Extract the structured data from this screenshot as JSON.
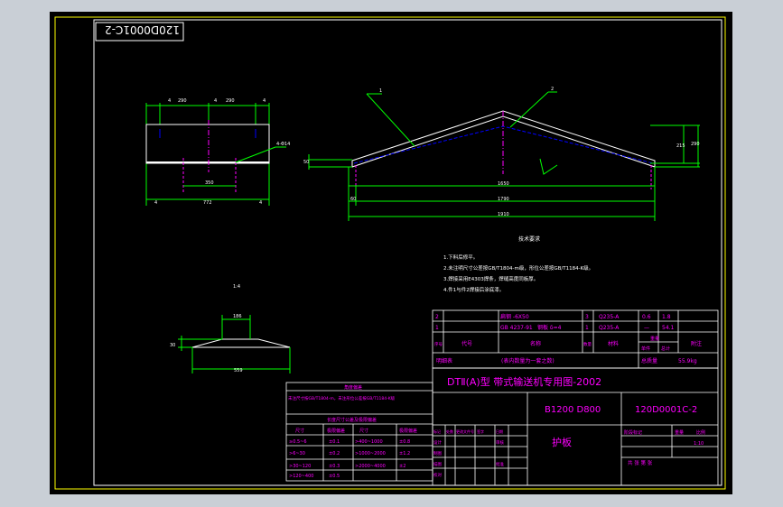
{
  "drawing_number": "120D0001C-2",
  "left_view": {
    "dim_top": [
      "4",
      "290",
      "4",
      "290",
      "4"
    ],
    "dim_mid": "350",
    "dim_bottom": [
      "4",
      "772",
      "4"
    ],
    "side_callout": "4-Φ14"
  },
  "main_view": {
    "callouts": [
      "1",
      "2"
    ],
    "dims": {
      "left_height": "50",
      "right_inner": "215",
      "right_outer": "290",
      "inner_width": "1650",
      "mid_width": "1790",
      "outer_width": "1910",
      "left_offset": "60"
    }
  },
  "tech_req": {
    "title": "技术要求",
    "items": [
      "1.下料后修平。",
      "2.未注明尺寸公差按GB/T1804-m级，形位公差按GB/T1184-K级。",
      "3.焊接采用E4303焊条，焊缝高度同板厚。",
      "4.件1与件2焊接后涂底漆。"
    ]
  },
  "scale_note": "1:4",
  "section_view": {
    "top_dim": "186",
    "height_dim": "30",
    "bottom_dim": "559"
  },
  "bom": {
    "rows": [
      {
        "no": "2",
        "code": "扁钢 -6X50",
        "name": "",
        "qty": "3",
        "material": "Q235-A",
        "unit_wt": "0.6",
        "total_wt": "1.8",
        "note": ""
      },
      {
        "no": "1",
        "code": "GB 4237-91",
        "name": "钢板 δ=4",
        "qty": "1",
        "material": "Q235-A",
        "unit_wt": "—",
        "total_wt": "54.1",
        "note": ""
      }
    ],
    "header": {
      "no": "序号",
      "code": "代号",
      "name": "名称",
      "qty": "数量",
      "material": "材料",
      "weight_single": "单件",
      "weight_total": "总计",
      "weight": "重量",
      "note": "附注"
    },
    "footer": {
      "label": "明细表",
      "note": "(表内数量为一套之数)",
      "total_label": "总质量",
      "total": "55.9kg"
    }
  },
  "title_block": {
    "series": "DTⅡ(A)型 带式输送机专用图-2002",
    "spec": "B1200  D800",
    "code": "120D0001C-2",
    "part_name": "护板",
    "stage_label": "阶段标记",
    "weight_label": "重量",
    "scale_label": "比例",
    "scale": "1:10",
    "sheets": "共  张  第  张",
    "sign_cols": [
      "标记",
      "处数",
      "更改文件号",
      "签字",
      "日期"
    ],
    "sign_rows": [
      "设计",
      "制图",
      "描图",
      "校对",
      "审核",
      "批准"
    ]
  },
  "tolerance_table": {
    "title": "角度偏差",
    "note": "未注尺寸按GB/T1804-m，未注形位公差按GB/T1184-K级",
    "subtitle": "长度尺寸公差及极限偏差",
    "headers": [
      "尺寸",
      "极限偏差",
      "尺寸",
      "极限偏差",
      "尺寸",
      "极限偏差"
    ],
    "rows": [
      [
        "≥0.5~6",
        "±0.1",
        ">400~1000",
        "±0.8"
      ],
      [
        ">6~30",
        "±0.2",
        ">1000~2000",
        "±1.2"
      ],
      [
        ">30~120",
        "±0.3",
        ">2000~4000",
        "±2"
      ],
      [
        ">120~400",
        "±0.5",
        "",
        ""
      ]
    ]
  },
  "colors": {
    "background": "#c9cfd6",
    "sheet": "#000000",
    "frame": "#ffff00",
    "dimension": "#00ff00",
    "outline": "#ffffff",
    "text": "#ff00ff",
    "hidden": "#0000ff"
  }
}
